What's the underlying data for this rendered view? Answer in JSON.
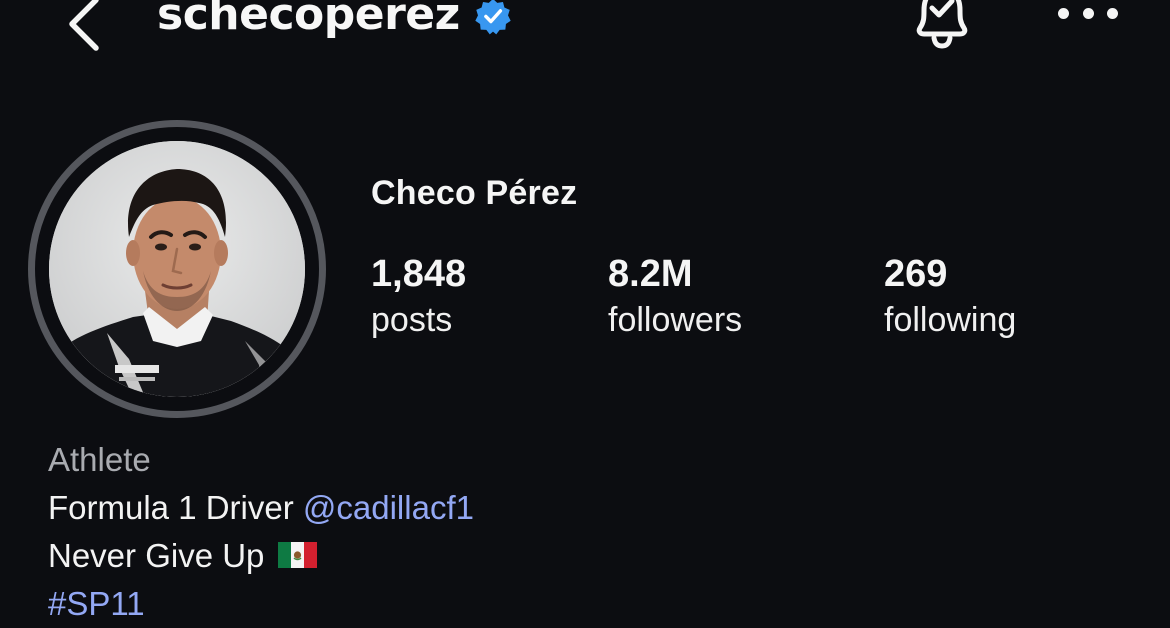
{
  "header": {
    "username": "schecoperez",
    "verified_badge": "verified-badge-icon",
    "icons": [
      "back-chevron-icon",
      "notification-bell-icon",
      "more-options-icon"
    ]
  },
  "profile": {
    "display_name": "Checo Pérez",
    "avatar": "profile-photo"
  },
  "stats": {
    "posts": {
      "count": "1,848",
      "label": "posts"
    },
    "followers": {
      "count": "8.2M",
      "label": "followers"
    },
    "following": {
      "count": "269",
      "label": "following"
    }
  },
  "bio": {
    "category": "Athlete",
    "line1_text": "Formula 1 Driver",
    "line1_mention": "@cadillacf1",
    "line2_text": "Never Give Up",
    "line2_emoji": "mexico-flag-icon",
    "hashtag": "#SP11"
  },
  "colors": {
    "background": "#0c0d11",
    "link": "#93a8f4",
    "verified": "#3897f0",
    "category": "#a9abb0"
  }
}
